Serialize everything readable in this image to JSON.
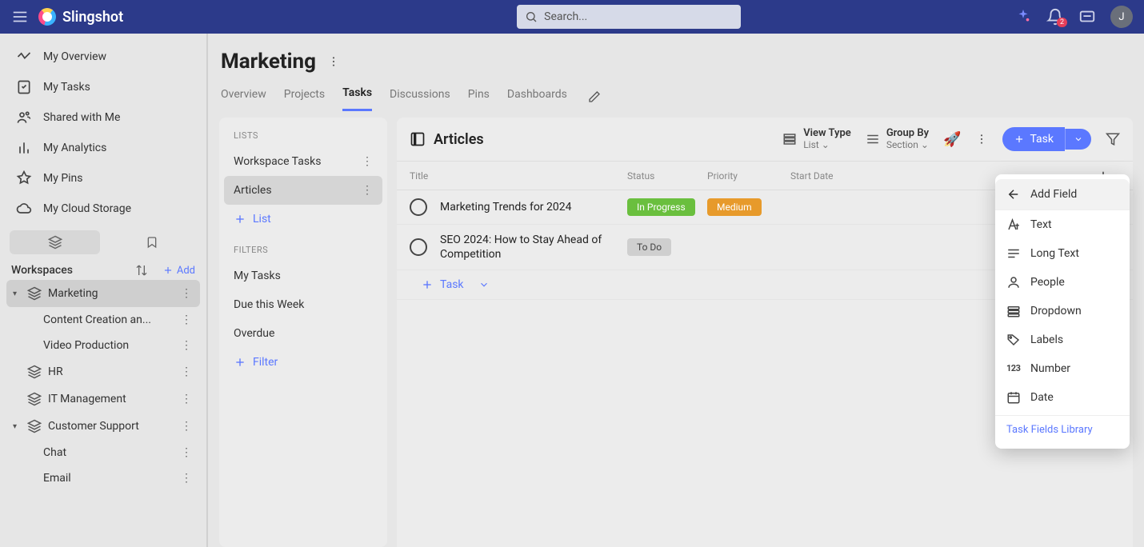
{
  "brand": "Slingshot",
  "search_placeholder": "Search...",
  "notification_count": "2",
  "avatar_initial": "J",
  "sidebar_nav": [
    {
      "label": "My Overview"
    },
    {
      "label": "My Tasks"
    },
    {
      "label": "Shared with Me"
    },
    {
      "label": "My Analytics"
    },
    {
      "label": "My Pins"
    },
    {
      "label": "My Cloud Storage"
    }
  ],
  "workspaces_label": "Workspaces",
  "add_label": "Add",
  "workspaces": [
    {
      "name": "Marketing",
      "expanded": true,
      "active": true,
      "children": [
        {
          "name": "Content Creation an..."
        },
        {
          "name": "Video Production"
        }
      ]
    },
    {
      "name": "HR",
      "expanded": false
    },
    {
      "name": "IT Management",
      "expanded": false
    },
    {
      "name": "Customer Support",
      "expanded": true,
      "children": [
        {
          "name": "Chat"
        },
        {
          "name": "Email"
        }
      ]
    }
  ],
  "page_title": "Marketing",
  "tabs": [
    "Overview",
    "Projects",
    "Tasks",
    "Discussions",
    "Pins",
    "Dashboards"
  ],
  "active_tab": "Tasks",
  "lists_panel": {
    "lists_label": "LISTS",
    "items": [
      {
        "name": "Workspace Tasks"
      },
      {
        "name": "Articles",
        "active": true
      }
    ],
    "add_list": "List",
    "filters_label": "FILTERS",
    "filters": [
      "My Tasks",
      "Due this Week",
      "Overdue"
    ],
    "add_filter": "Filter"
  },
  "task_view": {
    "title": "Articles",
    "view_type_label": "View Type",
    "view_type_value": "List",
    "group_by_label": "Group By",
    "group_by_value": "Section",
    "new_task_btn": "Task",
    "columns": [
      "Title",
      "Status",
      "Priority",
      "Start Date"
    ],
    "rows": [
      {
        "title": "Marketing Trends for 2024",
        "status": "In Progress",
        "status_class": "progress",
        "priority": "Medium",
        "priority_class": "medium"
      },
      {
        "title": "SEO 2024: How to Stay Ahead of Competition",
        "status": "To Do",
        "status_class": "todo"
      }
    ],
    "add_task": "Task"
  },
  "popup": {
    "header": "Add Field",
    "options": [
      "Text",
      "Long Text",
      "People",
      "Dropdown",
      "Labels",
      "Number",
      "Date"
    ],
    "footer_link": "Task Fields Library"
  }
}
